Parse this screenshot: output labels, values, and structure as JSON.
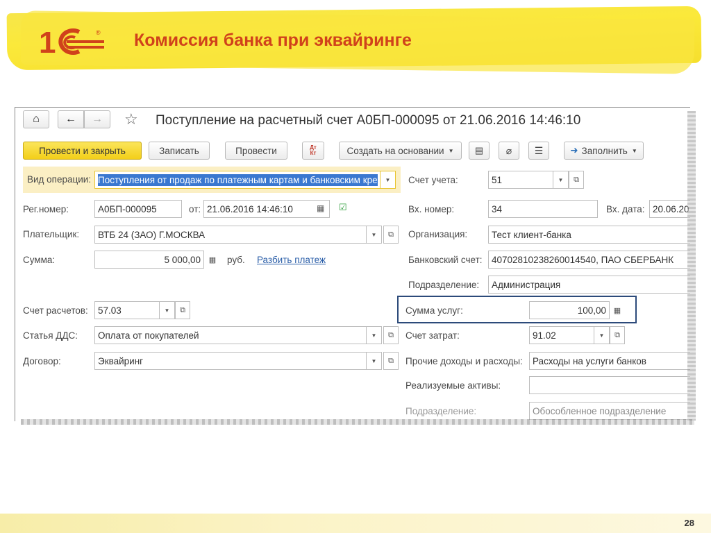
{
  "slide": {
    "title": "Комиссия банка при эквайринге",
    "page_number": "28",
    "logo_text": "1С"
  },
  "window": {
    "title": "Поступление на расчетный счет А0БП-000095 от 21.06.2016 14:46:10",
    "nav": {
      "home": "⌂",
      "back": "←",
      "forward": "→",
      "favorite": "☆"
    }
  },
  "toolbar": {
    "post_close": "Провести и закрыть",
    "save": "Записать",
    "post": "Провести",
    "dt_kt": "Дт Кт",
    "create_based": "Создать на основании",
    "fill": "Заполнить"
  },
  "form": {
    "operation_label": "Вид операции:",
    "operation_value": "Поступления от продаж по платежным картам и банковским кре",
    "reg_label": "Рег.номер:",
    "reg_value": "А0БП-000095",
    "from_label": "от:",
    "date_value": "21.06.2016 14:46:10",
    "payer_label": "Плательщик:",
    "payer_value": "ВТБ 24 (ЗАО) Г.МОСКВА",
    "sum_label": "Сумма:",
    "sum_value": "5 000,00",
    "currency": "руб.",
    "split_link": "Разбить платеж",
    "settle_account_label": "Счет расчетов:",
    "settle_account_value": "57.03",
    "dds_label": "Статья ДДС:",
    "dds_value": "Оплата от покупателей",
    "contract_label": "Договор:",
    "contract_value": "Эквайринг",
    "account_label": "Счет учета:",
    "account_value": "51",
    "in_number_label": "Вх. номер:",
    "in_number_value": "34",
    "in_date_label": "Вх. дата:",
    "in_date_value": "20.06.20",
    "org_label": "Организация:",
    "org_value": "Тест клиент-банка",
    "bank_account_label": "Банковский счет:",
    "bank_account_value": "40702810238260014540, ПАО СБЕРБАНК",
    "division_label": "Подразделение:",
    "division_value": "Администрация",
    "service_sum_label": "Сумма услуг:",
    "service_sum_value": "100,00",
    "cost_account_label": "Счет затрат:",
    "cost_account_value": "91.02",
    "other_income_label": "Прочие доходы и расходы:",
    "other_income_value": "Расходы на услуги банков",
    "assets_label": "Реализуемые активы:",
    "assets_value": "",
    "division2_label": "Подразделение:",
    "division2_value": "Обособленное подразделение"
  },
  "colors": {
    "accent_yellow": "#f3cf19",
    "title_red": "#d0421b",
    "highlight_border": "#2c4a7a",
    "selection": "#3a78d0"
  }
}
